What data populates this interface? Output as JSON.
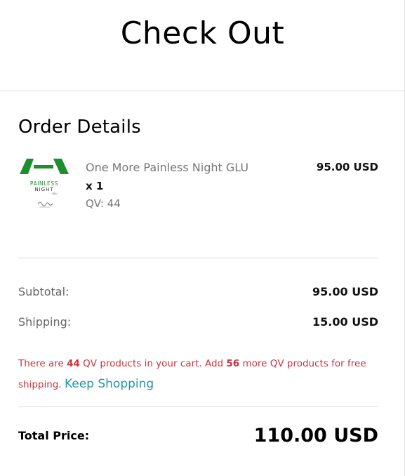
{
  "header": {
    "title": "Check Out"
  },
  "order": {
    "section_title": "Order Details",
    "item": {
      "name": "One More Painless Night GLU",
      "qty": "x 1",
      "qv": "QV: 44",
      "price": "95.00 USD",
      "image_alt_text": "PAINLESS NIGHT GLU"
    }
  },
  "summary": {
    "subtotal_label": "Subtotal:",
    "subtotal_value": "95.00 USD",
    "shipping_label": "Shipping:",
    "shipping_value": "15.00 USD"
  },
  "notice": {
    "part1": "There are ",
    "qv_in_cart": "44",
    "part2": " QV products in your cart. Add ",
    "qv_needed": "56",
    "part3": " more QV products for free shipping.",
    "link": "Keep Shopping"
  },
  "total": {
    "label": "Total Price:",
    "value": "110.00 USD"
  },
  "colors": {
    "notice_red": "#c9353f",
    "link_teal": "#2596a5",
    "logo_green": "#1e8f2e"
  },
  "icons": {
    "product_thumb": "product-image"
  }
}
